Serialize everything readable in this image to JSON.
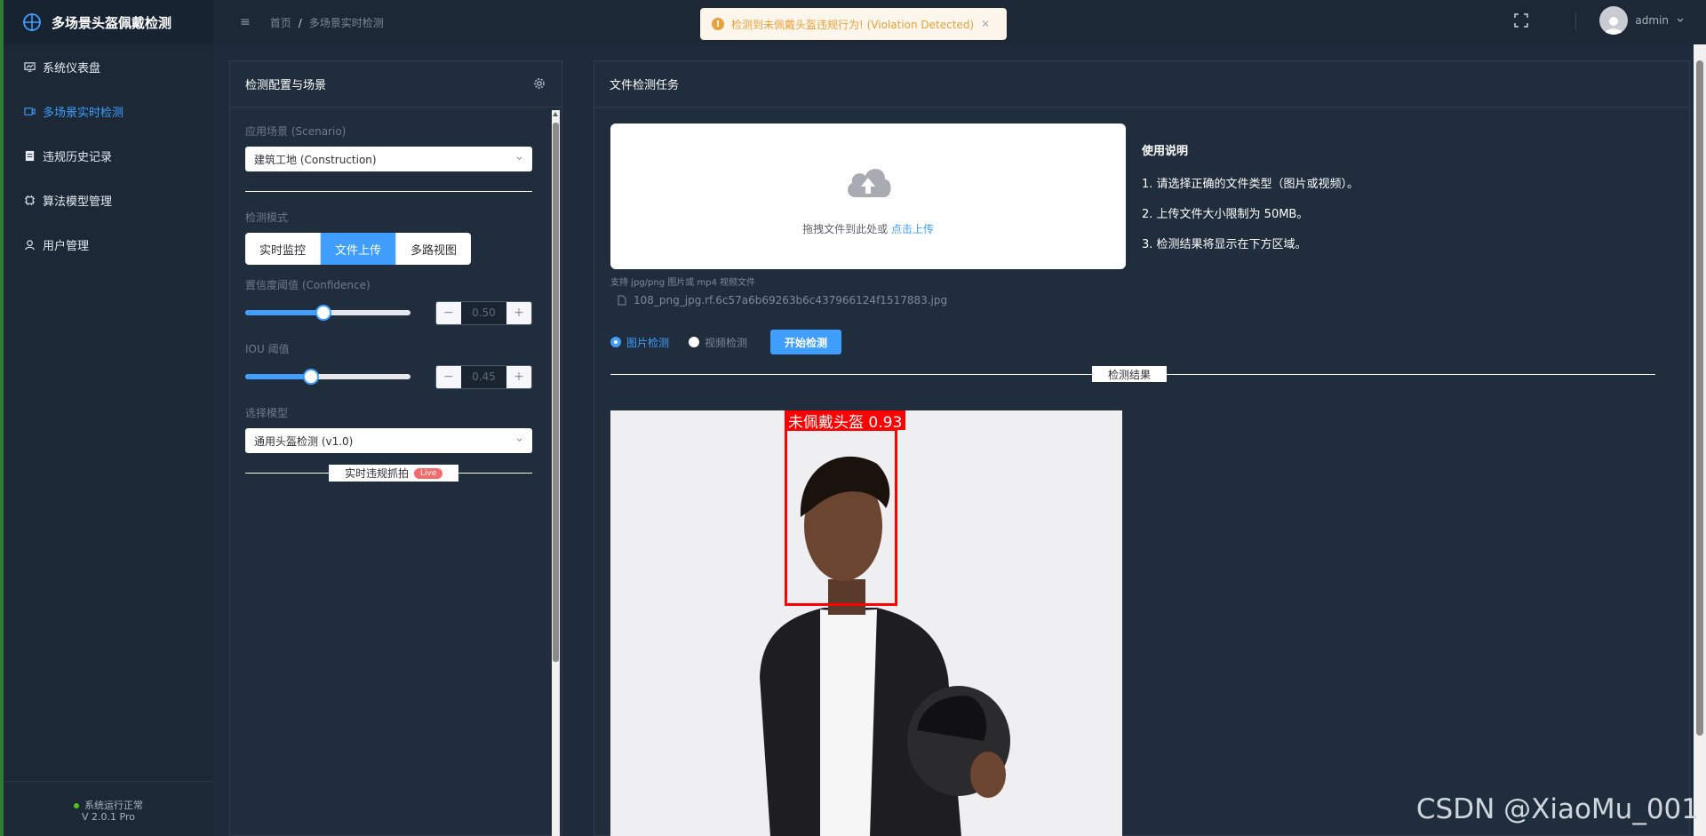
{
  "app": {
    "title": "多场景头盔佩戴检测"
  },
  "sidebar": {
    "items": [
      {
        "label": "系统仪表盘",
        "icon": "dashboard-icon"
      },
      {
        "label": "多场景实时检测",
        "icon": "video-camera-icon",
        "active": true
      },
      {
        "label": "违规历史记录",
        "icon": "document-icon"
      },
      {
        "label": "算法模型管理",
        "icon": "cpu-icon"
      },
      {
        "label": "用户管理",
        "icon": "user-icon"
      }
    ],
    "status": "系统运行正常",
    "version": "V 2.0.1 Pro"
  },
  "header": {
    "breadcrumb": [
      "首页",
      "多场景实时检测"
    ],
    "user": "admin"
  },
  "toast": {
    "message": "检测到未佩戴头盔违规行为! (Violation Detected)"
  },
  "config": {
    "title": "检测配置与场景",
    "scenario_label": "应用场景 (Scenario)",
    "scenario_value": "建筑工地 (Construction)",
    "mode_label": "检测模式",
    "modes": [
      "实时监控",
      "文件上传",
      "多路视图"
    ],
    "active_mode_index": 1,
    "confidence_label": "置信度阈值 (Confidence)",
    "confidence_value": "0.50",
    "confidence_level": 0.45,
    "iou_label": "IOU 阈值",
    "iou_value": "0.45",
    "iou_level": 0.38,
    "model_label": "选择模型",
    "model_value": "通用头盔检测 (v1.0)",
    "capture_label": "实时违规抓拍",
    "capture_badge": "Live"
  },
  "task": {
    "title": "文件检测任务",
    "upload_text": "拖拽文件到此处或 ",
    "upload_link": "点击上传",
    "tip": "支持 jpg/png 图片或 mp4 视频文件",
    "filename": "108_png_jpg.rf.6c57a6b69263b6c437966124f1517883.jpg",
    "radio_image": "图片检测",
    "radio_video": "视频检测",
    "start_button": "开始检测",
    "result_divider": "检测结果",
    "instructions_title": "使用说明",
    "instructions": [
      "1. 请选择正确的文件类型（图片或视频）。",
      "2. 上传文件大小限制为 50MB。",
      "3. 检测结果将显示在下方区域。"
    ],
    "detection_label": "未佩戴头盔 0.93"
  },
  "watermark": "CSDN @XiaoMu_001",
  "colors": {
    "accent": "#409eff",
    "danger": "#ff0000",
    "warning": "#e6a23c",
    "status_ok": "#52c41a"
  }
}
